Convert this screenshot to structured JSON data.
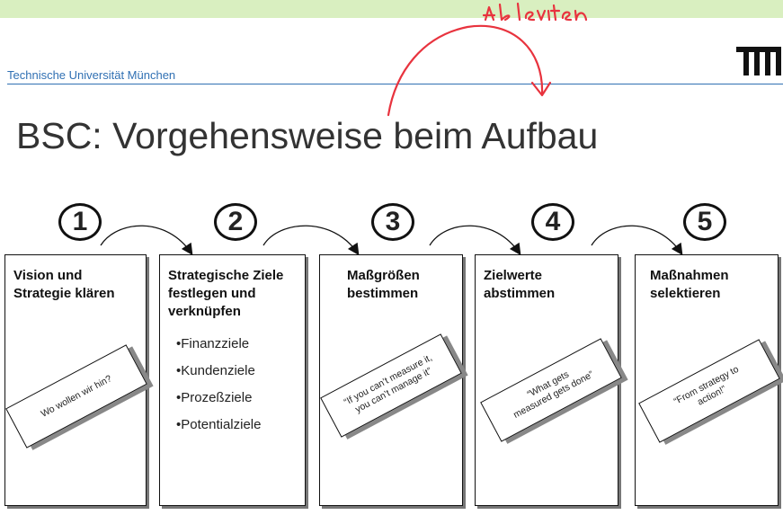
{
  "header": {
    "institution": "Technische Universität München",
    "logo": "TUM",
    "annotation": "ableiten"
  },
  "slide_title": "BSC: Vorgehensweise beim Aufbau",
  "steps": [
    {
      "number": "1",
      "title_lines": [
        "Vision und",
        "Strategie klären"
      ],
      "note_lines": [
        "Wo wollen wir hin?"
      ]
    },
    {
      "number": "2",
      "title_lines": [
        "Strategische Ziele",
        "festlegen und",
        "verknüpfen"
      ],
      "items": [
        "•Finanzziele",
        "•Kundenziele",
        "•Prozeßziele",
        "•Potentialziele"
      ]
    },
    {
      "number": "3",
      "title_lines": [
        "Maßgrößen",
        "bestimmen"
      ],
      "note_lines": [
        "“If you can’t measure it,",
        "you can’t manage it”"
      ]
    },
    {
      "number": "4",
      "title_lines": [
        "Zielwerte",
        "abstimmen"
      ],
      "note_lines": [
        "“What gets",
        "measured gets done”"
      ]
    },
    {
      "number": "5",
      "title_lines": [
        "Maßnahmen",
        "selektieren"
      ],
      "note_lines": [
        "“From strategy to",
        "action!”"
      ]
    }
  ]
}
